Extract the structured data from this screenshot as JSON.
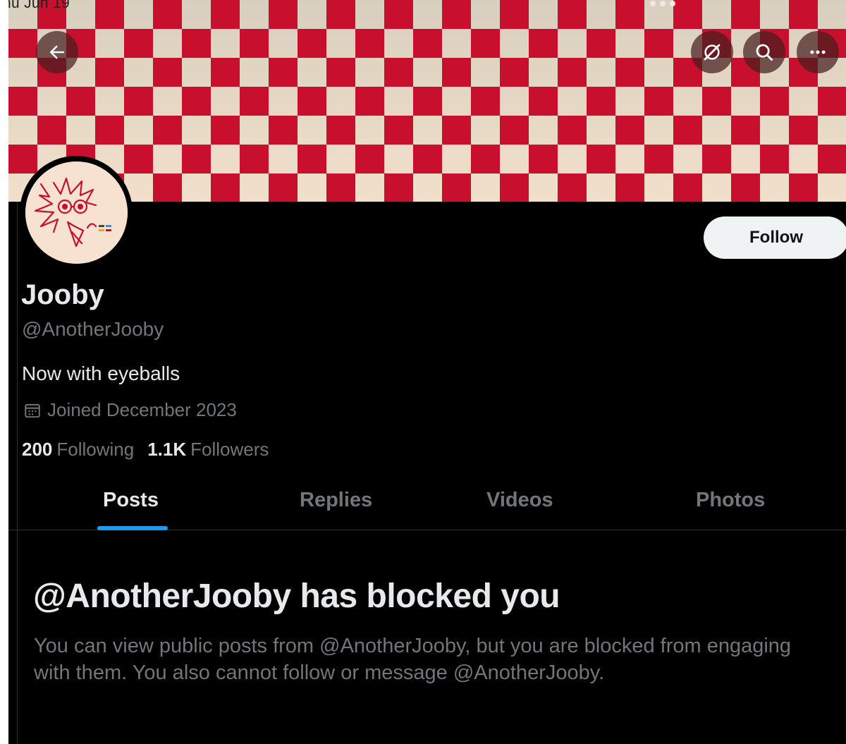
{
  "status_bar": {
    "date": "hu Jun 19"
  },
  "header": {
    "back_icon": "arrow-left-icon",
    "grok_icon": "grok-icon",
    "search_icon": "search-icon",
    "more_icon": "more-horizontal-icon"
  },
  "banner": {
    "pattern": "checkerboard",
    "colors": [
      "#c8102e",
      "#f1dfca"
    ]
  },
  "profile": {
    "display_name": "Jooby",
    "handle": "@AnotherJooby",
    "bio": "Now with eyeballs",
    "joined": "Joined December 2023",
    "following_count": "200",
    "following_label": "Following",
    "followers_count": "1.1K",
    "followers_label": "Followers",
    "follow_label": "Follow"
  },
  "tabs": [
    {
      "label": "Posts",
      "active": true
    },
    {
      "label": "Replies",
      "active": false
    },
    {
      "label": "Videos",
      "active": false
    },
    {
      "label": "Photos",
      "active": false
    }
  ],
  "blocked": {
    "title": "@AnotherJooby has blocked you",
    "description": "You can view public posts from @AnotherJooby, but you are blocked from engaging with them. You also cannot follow or message @AnotherJooby."
  },
  "colors": {
    "background": "#000000",
    "text_primary": "#e7e9ea",
    "text_secondary": "#71767b",
    "accent": "#1d9bf0",
    "follow_button_bg": "#eff3f4"
  }
}
